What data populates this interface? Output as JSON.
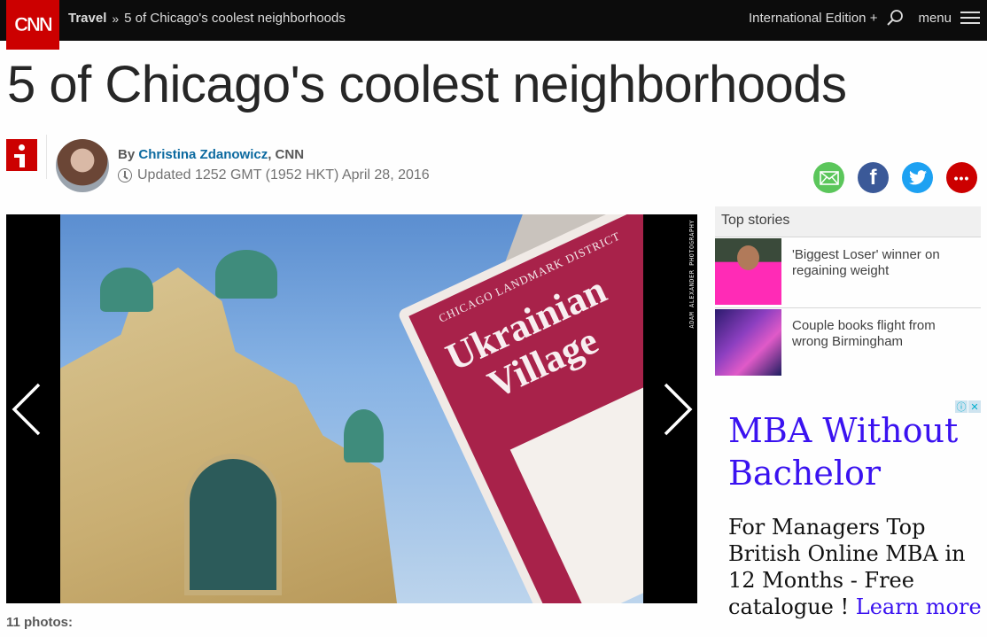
{
  "nav": {
    "logo": "CNN",
    "breadcrumb": {
      "section": "Travel",
      "separator": "»",
      "current": "5 of Chicago's coolest neighborhoods"
    },
    "edition": "International Edition +",
    "menu_label": "menu"
  },
  "article": {
    "headline": "5 of Chicago's coolest neighborhoods",
    "byline_prefix": "By",
    "author": "Christina Zdanowicz",
    "byline_suffix": ", CNN",
    "updated": "Updated 1252 GMT (1952 HKT) April 28, 2016"
  },
  "share": [
    {
      "name": "email",
      "color": "#5bc65b"
    },
    {
      "name": "facebook",
      "color": "#3b5998",
      "label": "f"
    },
    {
      "name": "twitter",
      "color": "#1da1f2"
    },
    {
      "name": "more",
      "color": "#cc0000",
      "label": "•••"
    }
  ],
  "gallery": {
    "photo_credit": "ADAM ALEXANDER PHOTOGRAPHY",
    "sign_line1": "CHICAGO LANDMARK DISTRICT",
    "sign_line2": "Ukrainian",
    "sign_line3": "Village",
    "photo_count": "11 photos:"
  },
  "top_stories": {
    "header": "Top stories",
    "items": [
      {
        "title": "'Biggest Loser' winner on regaining weight"
      },
      {
        "title": "Couple books flight from wrong Birmingham"
      }
    ]
  },
  "ad": {
    "title": "MBA Without Bachelor",
    "body": "For Managers Top British Online MBA in 12 Months - Free catalogue ! ",
    "link": "Learn more",
    "info_icon": "ⓘ",
    "close_icon": "✕"
  },
  "colors": {
    "brand_red": "#cc0000",
    "nav_bg": "#0c0c0c",
    "author_link": "#0c6aa0",
    "ad_link": "#3a12f0"
  }
}
